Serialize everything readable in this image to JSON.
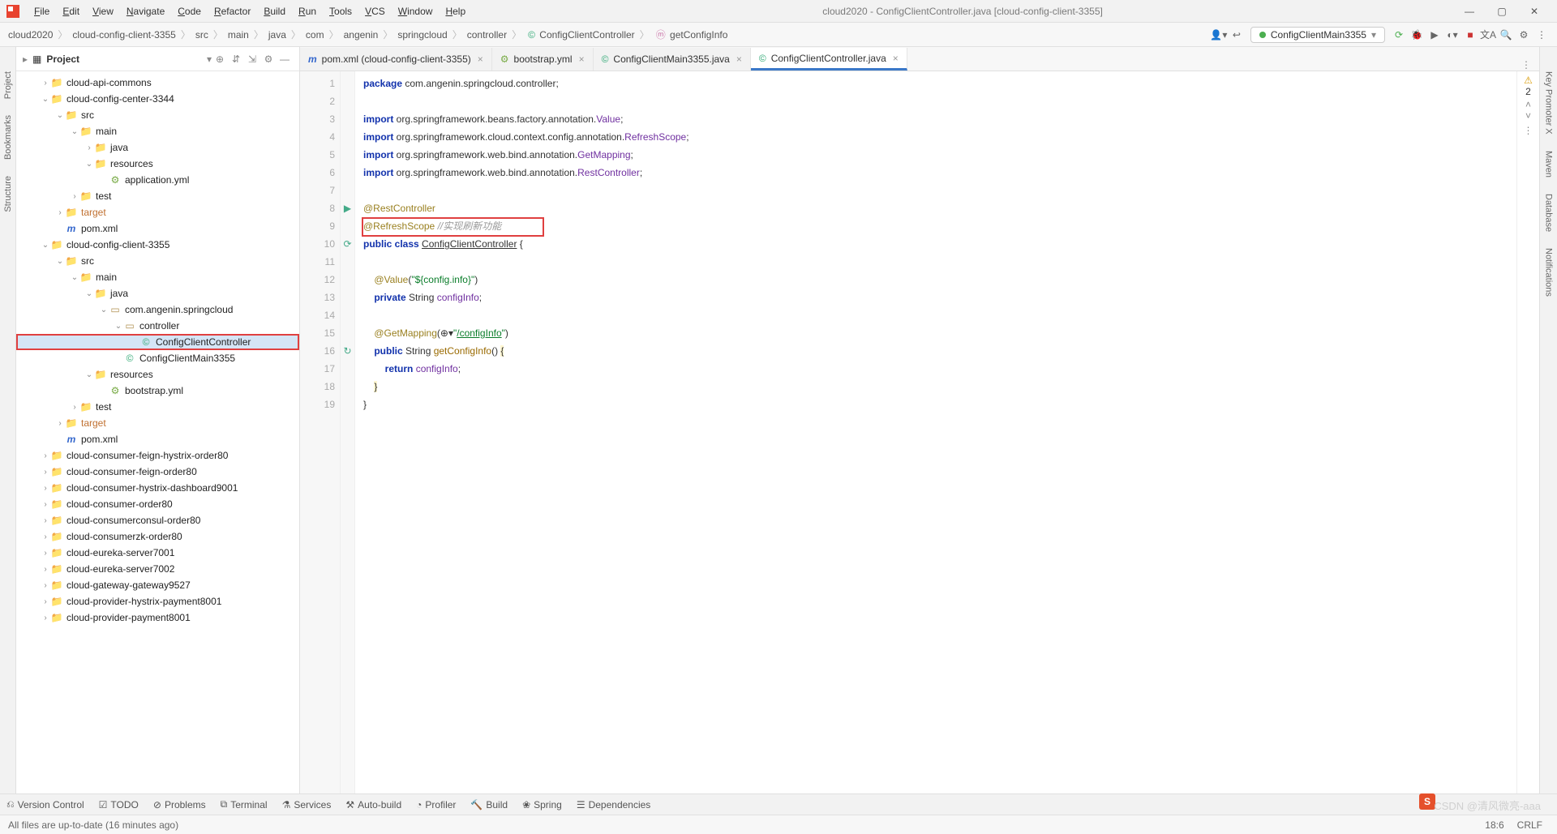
{
  "window": {
    "title": "cloud2020 - ConfigClientController.java [cloud-config-client-3355]"
  },
  "menu": [
    "File",
    "Edit",
    "View",
    "Navigate",
    "Code",
    "Refactor",
    "Build",
    "Run",
    "Tools",
    "VCS",
    "Window",
    "Help"
  ],
  "breadcrumbs": [
    "cloud2020",
    "cloud-config-client-3355",
    "src",
    "main",
    "java",
    "com",
    "angenin",
    "springcloud",
    "controller",
    "ConfigClientController",
    "getConfigInfo"
  ],
  "runConfig": "ConfigClientMain3355",
  "projectPanel": {
    "title": "Project"
  },
  "tree": [
    {
      "d": 1,
      "t": "folder",
      "a": ">",
      "l": "cloud-api-commons",
      "mod": true
    },
    {
      "d": 1,
      "t": "folder",
      "a": "v",
      "l": "cloud-config-center-3344",
      "mod": true
    },
    {
      "d": 2,
      "t": "folder",
      "a": "v",
      "l": "src"
    },
    {
      "d": 3,
      "t": "folder",
      "a": "v",
      "l": "main"
    },
    {
      "d": 4,
      "t": "folder",
      "a": ">",
      "l": "java"
    },
    {
      "d": 4,
      "t": "folder",
      "a": "v",
      "l": "resources"
    },
    {
      "d": 5,
      "t": "file",
      "a": "",
      "l": "application.yml",
      "icon": "yml"
    },
    {
      "d": 3,
      "t": "folder",
      "a": ">",
      "l": "test"
    },
    {
      "d": 2,
      "t": "folder",
      "a": ">",
      "l": "target",
      "ex": true
    },
    {
      "d": 2,
      "t": "file",
      "a": "",
      "l": "pom.xml",
      "icon": "m"
    },
    {
      "d": 1,
      "t": "folder",
      "a": "v",
      "l": "cloud-config-client-3355",
      "mod": true
    },
    {
      "d": 2,
      "t": "folder",
      "a": "v",
      "l": "src"
    },
    {
      "d": 3,
      "t": "folder",
      "a": "v",
      "l": "main"
    },
    {
      "d": 4,
      "t": "folder",
      "a": "v",
      "l": "java"
    },
    {
      "d": 5,
      "t": "pkg",
      "a": "v",
      "l": "com.angenin.springcloud"
    },
    {
      "d": 6,
      "t": "pkg",
      "a": "v",
      "l": "controller",
      "hlText": true
    },
    {
      "d": 7,
      "t": "file",
      "a": "",
      "l": "ConfigClientController",
      "icon": "c",
      "sel": true,
      "hl": true
    },
    {
      "d": 6,
      "t": "file",
      "a": "",
      "l": "ConfigClientMain3355",
      "icon": "c"
    },
    {
      "d": 4,
      "t": "folder",
      "a": "v",
      "l": "resources"
    },
    {
      "d": 5,
      "t": "file",
      "a": "",
      "l": "bootstrap.yml",
      "icon": "yml"
    },
    {
      "d": 3,
      "t": "folder",
      "a": ">",
      "l": "test"
    },
    {
      "d": 2,
      "t": "folder",
      "a": ">",
      "l": "target",
      "ex": true
    },
    {
      "d": 2,
      "t": "file",
      "a": "",
      "l": "pom.xml",
      "icon": "m"
    },
    {
      "d": 1,
      "t": "folder",
      "a": ">",
      "l": "cloud-consumer-feign-hystrix-order80",
      "mod": true
    },
    {
      "d": 1,
      "t": "folder",
      "a": ">",
      "l": "cloud-consumer-feign-order80",
      "mod": true
    },
    {
      "d": 1,
      "t": "folder",
      "a": ">",
      "l": "cloud-consumer-hystrix-dashboard9001",
      "mod": true
    },
    {
      "d": 1,
      "t": "folder",
      "a": ">",
      "l": "cloud-consumer-order80",
      "mod": true
    },
    {
      "d": 1,
      "t": "folder",
      "a": ">",
      "l": "cloud-consumerconsul-order80",
      "mod": true
    },
    {
      "d": 1,
      "t": "folder",
      "a": ">",
      "l": "cloud-consumerzk-order80",
      "mod": true
    },
    {
      "d": 1,
      "t": "folder",
      "a": ">",
      "l": "cloud-eureka-server7001",
      "mod": true
    },
    {
      "d": 1,
      "t": "folder",
      "a": ">",
      "l": "cloud-eureka-server7002",
      "mod": true
    },
    {
      "d": 1,
      "t": "folder",
      "a": ">",
      "l": "cloud-gateway-gateway9527",
      "mod": true
    },
    {
      "d": 1,
      "t": "folder",
      "a": ">",
      "l": "cloud-provider-hystrix-payment8001",
      "mod": true
    },
    {
      "d": 1,
      "t": "folder",
      "a": ">",
      "l": "cloud-provider-payment8001",
      "mod": true
    }
  ],
  "tabs": [
    {
      "icon": "m",
      "label": "pom.xml (cloud-config-client-3355)",
      "active": false
    },
    {
      "icon": "yml",
      "label": "bootstrap.yml",
      "active": false
    },
    {
      "icon": "c",
      "label": "ConfigClientMain3355.java",
      "active": false
    },
    {
      "icon": "c",
      "label": "ConfigClientController.java",
      "active": true
    }
  ],
  "code": {
    "lines": [
      {
        "n": 1,
        "html": "<span class='kw'>package</span> com.angenin.springcloud.controller;"
      },
      {
        "n": 2,
        "html": ""
      },
      {
        "n": 3,
        "html": "<span class='kw'>import</span> org.springframework.beans.factory.annotation.<span class='cls'>Value</span>;"
      },
      {
        "n": 4,
        "html": "<span class='kw'>import</span> org.springframework.cloud.context.config.annotation.<span class='cls'>RefreshScope</span>;"
      },
      {
        "n": 5,
        "html": "<span class='kw'>import</span> org.springframework.web.bind.annotation.<span class='cls'>GetMapping</span>;"
      },
      {
        "n": 6,
        "html": "<span class='kw'>import</span> org.springframework.web.bind.annotation.<span class='cls'>RestController</span>;"
      },
      {
        "n": 7,
        "html": ""
      },
      {
        "n": 8,
        "html": "<span class='ann'>@RestController</span>",
        "gutter": "▶"
      },
      {
        "n": 9,
        "html": "<span class='ann'>@RefreshScope</span> <span class='comment'>//实现刷新功能</span>"
      },
      {
        "n": 10,
        "html": "<span class='kw'>public class</span> <u>ConfigClientController</u> {",
        "gutter": "⟳"
      },
      {
        "n": 11,
        "html": ""
      },
      {
        "n": 12,
        "html": "    <span class='ann'>@Value</span>(<span class='str'>\"${config.info}\"</span>)"
      },
      {
        "n": 13,
        "html": "    <span class='kw'>private</span> String <span class='cls'>configInfo</span>;"
      },
      {
        "n": 14,
        "html": ""
      },
      {
        "n": 15,
        "html": "    <span class='ann'>@GetMapping</span>(⊕▾<span class='str'>\"<u>/configInfo</u>\"</span>)"
      },
      {
        "n": 16,
        "html": "    <span class='kw'>public</span> String <span class='method'>getConfigInfo</span>() <span class='hl'>{</span>",
        "gutter": "↻"
      },
      {
        "n": 17,
        "html": "        <span class='kw'>return</span> <span class='cls'>configInfo</span>;"
      },
      {
        "n": 18,
        "html": "    <span class='hl'>}</span>"
      },
      {
        "n": 19,
        "html": "}"
      }
    ]
  },
  "inspection": {
    "warnings": "2"
  },
  "leftTabs": [
    "Project",
    "Bookmarks",
    "Structure"
  ],
  "rightTabs": [
    "Key Promoter X",
    "Maven",
    "Database",
    "Notifications"
  ],
  "bottomTools": [
    "Version Control",
    "TODO",
    "Problems",
    "Terminal",
    "Services",
    "Auto-build",
    "Profiler",
    "Build",
    "Spring",
    "Dependencies"
  ],
  "status": {
    "msg": "All files are up-to-date (16 minutes ago)",
    "pos": "18:6",
    "eol": "CRLF"
  },
  "watermark": "CSDN @清风微亮-aaa"
}
